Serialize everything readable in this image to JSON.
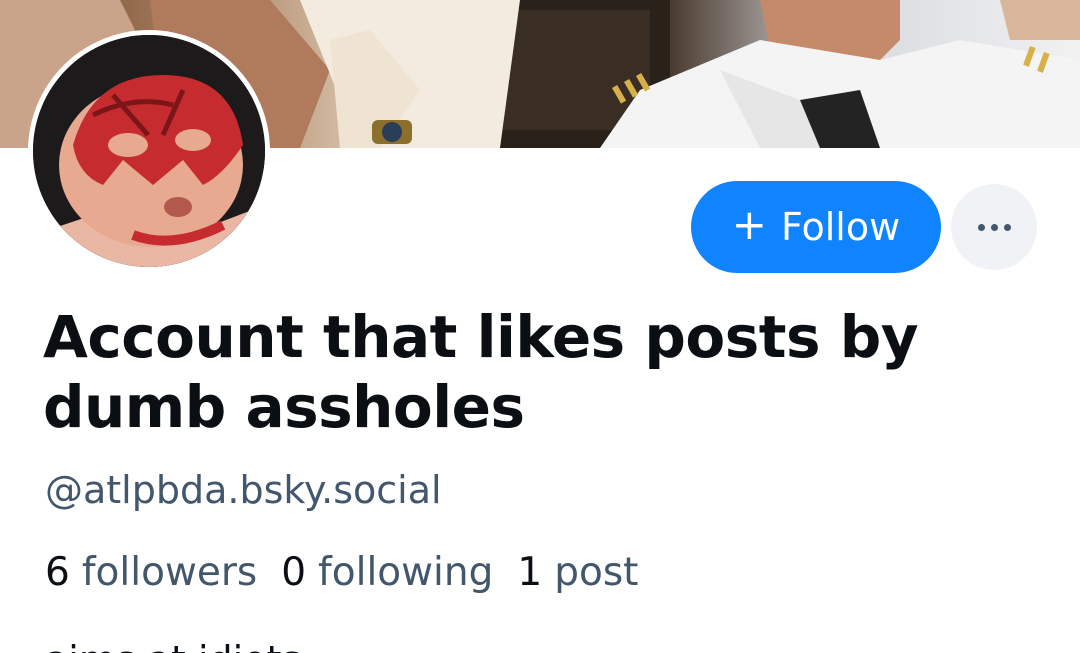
{
  "profile": {
    "display_name": "Account that likes posts by dumb assholes",
    "handle": "@atlpbda.bsky.social",
    "bio_preview": "aims at idiots"
  },
  "actions": {
    "follow_plus": "+",
    "follow_label": "Follow",
    "more_icon": "ellipsis-icon"
  },
  "stats": {
    "followers_count": "6",
    "followers_label": "followers",
    "following_count": "0",
    "following_label": "following",
    "posts_count": "1",
    "posts_label": "post"
  },
  "colors": {
    "accent": "#1083fe",
    "text_primary": "#0b0f14",
    "text_secondary": "#42576c",
    "more_button_bg": "#f0f2f5"
  }
}
